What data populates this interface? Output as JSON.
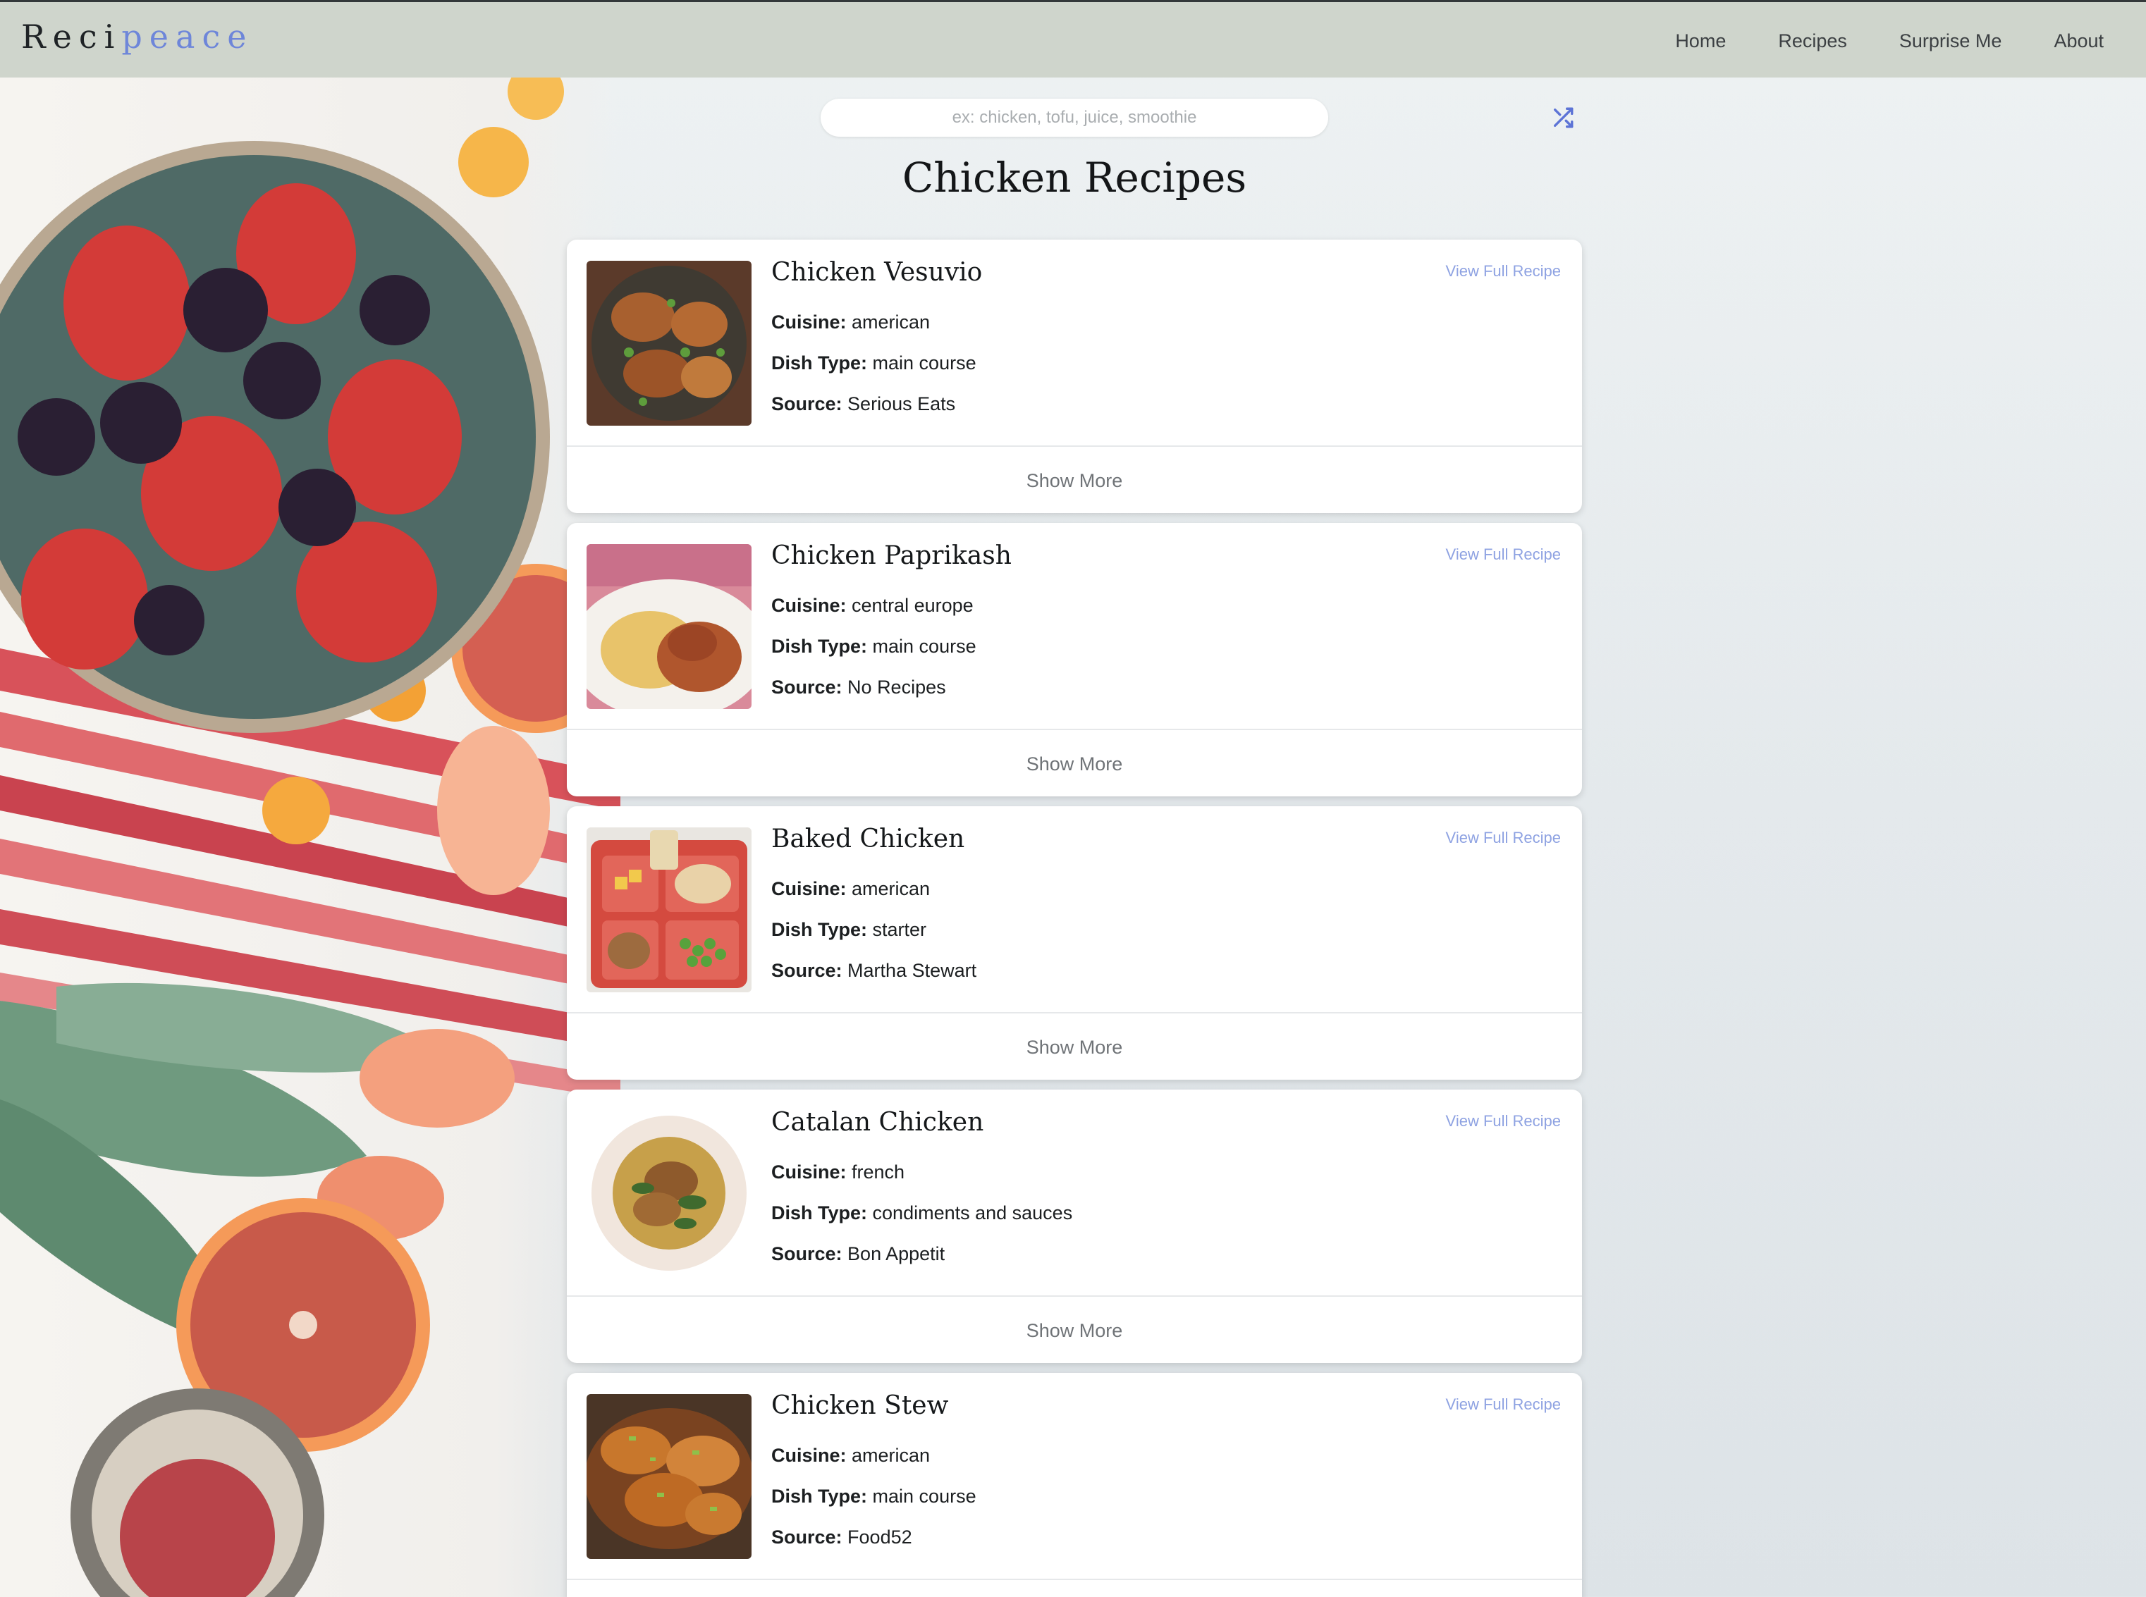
{
  "header": {
    "brand_part1": "Reci",
    "brand_part2": "peace",
    "nav": [
      "Home",
      "Recipes",
      "Surprise Me",
      "About"
    ]
  },
  "search": {
    "placeholder": "ex: chicken, tofu, juice, smoothie",
    "value": "",
    "shuffle_icon": "shuffle-icon"
  },
  "page_title": "Chicken Recipes",
  "labels": {
    "cuisine": "Cuisine:",
    "dish_type": "Dish Type:",
    "source": "Source:",
    "view_full": "View Full Recipe",
    "show_more": "Show More"
  },
  "recipes": [
    {
      "title": "Chicken Vesuvio",
      "cuisine": "american",
      "dish_type": "main course",
      "source": "Serious Eats"
    },
    {
      "title": "Chicken Paprikash",
      "cuisine": "central europe",
      "dish_type": "main course",
      "source": "No Recipes"
    },
    {
      "title": "Baked Chicken",
      "cuisine": "american",
      "dish_type": "starter",
      "source": "Martha Stewart"
    },
    {
      "title": "Catalan Chicken",
      "cuisine": "french",
      "dish_type": "condiments and sauces",
      "source": "Bon Appetit"
    },
    {
      "title": "Chicken Stew",
      "cuisine": "american",
      "dish_type": "main course",
      "source": "Food52"
    }
  ],
  "colors": {
    "nav_bg": "#cfd5cc",
    "brand_accent": "#6e86d9",
    "link": "#8ea2e2"
  }
}
